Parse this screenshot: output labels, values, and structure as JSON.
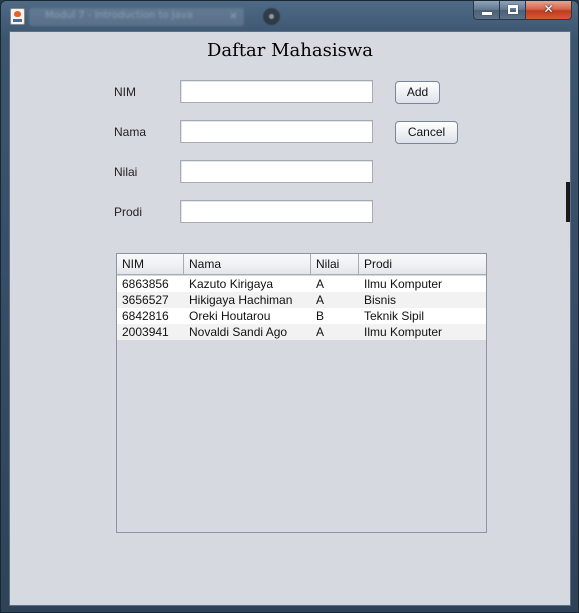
{
  "window": {
    "blurred_tab_text": "Modul 7 - Introduction to Java",
    "blurred_tab_close": "×",
    "controls": {
      "close": "✕"
    }
  },
  "form": {
    "title": "Daftar Mahasiswa",
    "fields": [
      {
        "label": "NIM",
        "value": ""
      },
      {
        "label": "Nama",
        "value": ""
      },
      {
        "label": "Nilai",
        "value": ""
      },
      {
        "label": "Prodi",
        "value": ""
      }
    ],
    "buttons": {
      "add": "Add",
      "cancel": "Cancel"
    }
  },
  "table": {
    "columns": [
      "NIM",
      "Nama",
      "Nilai",
      "Prodi"
    ],
    "rows": [
      [
        "6863856",
        "Kazuto Kirigaya",
        "A",
        "Ilmu Komputer"
      ],
      [
        "3656527",
        "Hikigaya Hachiman",
        "A",
        "Bisnis"
      ],
      [
        "6842816",
        "Oreki Houtarou",
        "B",
        "Teknik Sipil"
      ],
      [
        "2003941",
        "Novaldi Sandi Ago",
        "A",
        "Ilmu Komputer"
      ]
    ]
  }
}
